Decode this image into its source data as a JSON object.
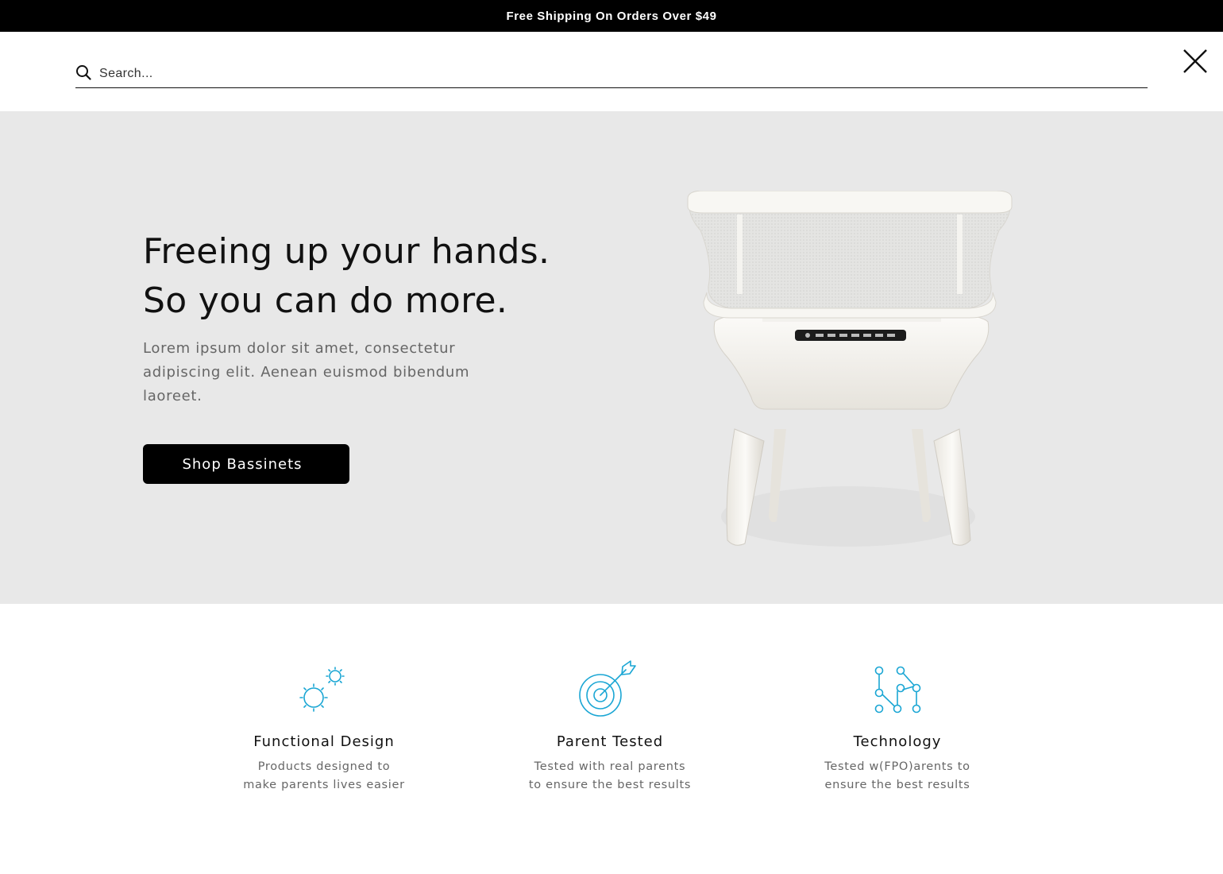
{
  "announcement": {
    "text": "Free Shipping On Orders Over $49"
  },
  "search": {
    "placeholder": "Search...",
    "value": ""
  },
  "hero": {
    "title_line1": "Freeing up your hands.",
    "title_line2": "So you can do more.",
    "description_line1": "Lorem ipsum dolor sit amet, consectetur",
    "description_line2": "adipiscing elit. Aenean euismod bibendum",
    "description_line3": "laoreet.",
    "button_label": "Shop Bassinets"
  },
  "features": [
    {
      "icon": "sun-sparkle-icon",
      "title": "Functional Design",
      "desc_line1": "Products designed to",
      "desc_line2": "make parents lives easier"
    },
    {
      "icon": "target-arrow-icon",
      "title": "Parent Tested",
      "desc_line1": "Tested with real parents",
      "desc_line2": "to ensure the best results"
    },
    {
      "icon": "circuit-nodes-icon",
      "title": "Technology",
      "desc_line1": "Tested w(FPO)arents to",
      "desc_line2": "ensure the best results"
    }
  ],
  "colors": {
    "accent": "#1aa6d4",
    "announcement_bg": "#000000",
    "hero_bg": "#e8e8e8",
    "button_bg": "#000000"
  }
}
